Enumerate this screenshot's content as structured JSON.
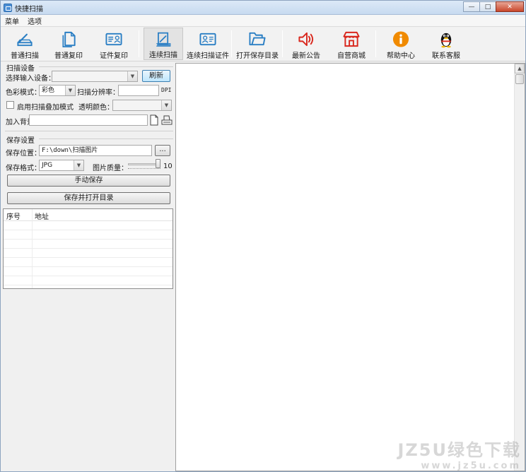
{
  "window": {
    "title": "快捷扫描",
    "buttons": {
      "minimize": "—",
      "maximize": "□",
      "close": "✕"
    }
  },
  "menu": [
    "菜单",
    "选项"
  ],
  "toolbar": [
    {
      "label": "普通扫描",
      "icon": "scanner-icon"
    },
    {
      "label": "普通复印",
      "icon": "copy-icon"
    },
    {
      "label": "证件复印",
      "icon": "id-card-icon"
    },
    {
      "label": "连续扫描",
      "icon": "continuous-scan-icon",
      "active": true
    },
    {
      "label": "连续扫描证件",
      "icon": "id-card-scan-icon"
    },
    {
      "label": "打开保存目录",
      "icon": "folder-icon"
    },
    {
      "label": "最新公告",
      "icon": "speaker-icon"
    },
    {
      "label": "自营商城",
      "icon": "shop-icon"
    },
    {
      "label": "帮助中心",
      "icon": "info-icon"
    },
    {
      "label": "联系客服",
      "icon": "qq-penguin-icon"
    }
  ],
  "scan": {
    "group": "扫描设备",
    "device_label": "选择输入设备：",
    "device_value": "",
    "refresh": "刷新",
    "color_label": "色彩模式：",
    "color_value": "彩色",
    "dpi_label": "扫描分辨率：",
    "dpi_value": "",
    "dpi_unit": "DPI",
    "overlay_label": "启用扫描叠加模式",
    "overlay_checked": false,
    "transparent_label": "透明颜色：",
    "background_label": "加入背景：",
    "background_value": ""
  },
  "save": {
    "group": "保存设置",
    "location_label": "保存位置：",
    "location_value": "F:\\down\\扫描图片",
    "browse": "...",
    "format_label": "保存格式：",
    "format_value": "JPG",
    "quality_label": "图片质量：",
    "quality_value": "10",
    "manual_save": "手动保存",
    "save_open": "保存并打开目录"
  },
  "table": {
    "columns": [
      "序号",
      "地址"
    ],
    "rows": []
  },
  "watermark": {
    "line1": "JZ5U绿色下载",
    "line2": "www.jz5u.com"
  },
  "colors": {
    "accent_blue": "#2b7fc4",
    "red": "#d9281e",
    "orange": "#f08a00"
  }
}
